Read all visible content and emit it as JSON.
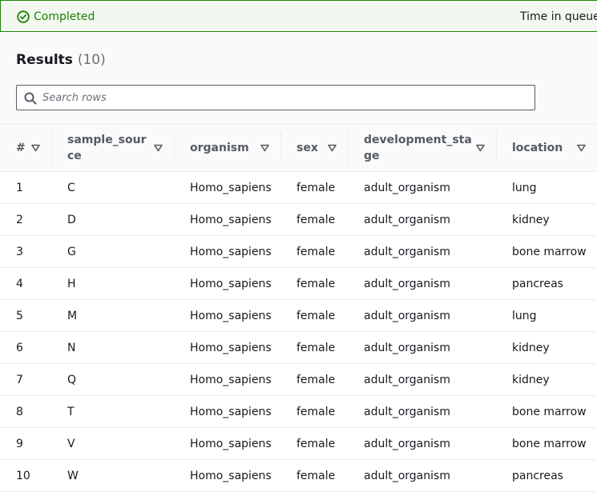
{
  "status": {
    "label": "Completed",
    "time_in_queue_label": "Time in queue:",
    "color": "#1d8102",
    "icon": "check-circle-icon"
  },
  "results": {
    "title": "Results",
    "count": "(10)"
  },
  "search": {
    "placeholder": "Search rows",
    "value": ""
  },
  "table": {
    "columns": [
      "#",
      "sample_source",
      "organism",
      "sex",
      "development_stage",
      "location"
    ],
    "sort_icon": "sort-triangle-icon",
    "rows": [
      [
        "1",
        "C",
        "Homo_sapiens",
        "female",
        "adult_organism",
        "lung"
      ],
      [
        "2",
        "D",
        "Homo_sapiens",
        "female",
        "adult_organism",
        "kidney"
      ],
      [
        "3",
        "G",
        "Homo_sapiens",
        "female",
        "adult_organism",
        "bone marrow"
      ],
      [
        "4",
        "H",
        "Homo_sapiens",
        "female",
        "adult_organism",
        "pancreas"
      ],
      [
        "5",
        "M",
        "Homo_sapiens",
        "female",
        "adult_organism",
        "lung"
      ],
      [
        "6",
        "N",
        "Homo_sapiens",
        "female",
        "adult_organism",
        "kidney"
      ],
      [
        "7",
        "Q",
        "Homo_sapiens",
        "female",
        "adult_organism",
        "kidney"
      ],
      [
        "8",
        "T",
        "Homo_sapiens",
        "female",
        "adult_organism",
        "bone marrow"
      ],
      [
        "9",
        "V",
        "Homo_sapiens",
        "female",
        "adult_organism",
        "bone marrow"
      ],
      [
        "10",
        "W",
        "Homo_sapiens",
        "female",
        "adult_organism",
        "pancreas"
      ]
    ]
  }
}
